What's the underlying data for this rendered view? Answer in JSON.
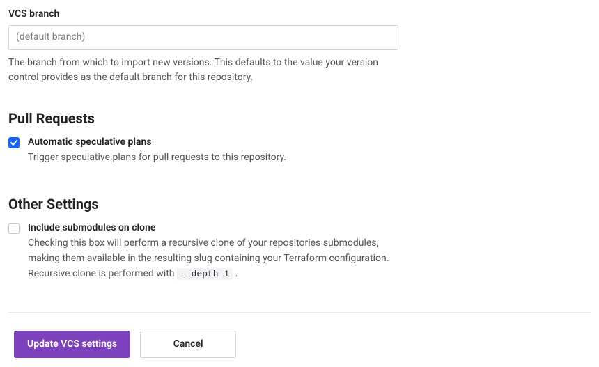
{
  "vcs_branch": {
    "label": "VCS branch",
    "placeholder": "(default branch)",
    "value": "",
    "help": "The branch from which to import new versions. This defaults to the value your version control provides as the default branch for this repository."
  },
  "pull_requests": {
    "heading": "Pull Requests",
    "auto_speculative": {
      "label": "Automatic speculative plans",
      "help": "Trigger speculative plans for pull requests to this repository.",
      "checked": true
    }
  },
  "other_settings": {
    "heading": "Other Settings",
    "include_submodules": {
      "label": "Include submodules on clone",
      "help_prefix": "Checking this box will perform a recursive clone of your repositories submodules, making them available in the resulting slug containing your Terraform configuration. Recursive clone is performed with ",
      "help_code": "--depth 1",
      "help_suffix": " .",
      "checked": false
    }
  },
  "buttons": {
    "update": "Update VCS settings",
    "cancel": "Cancel"
  }
}
